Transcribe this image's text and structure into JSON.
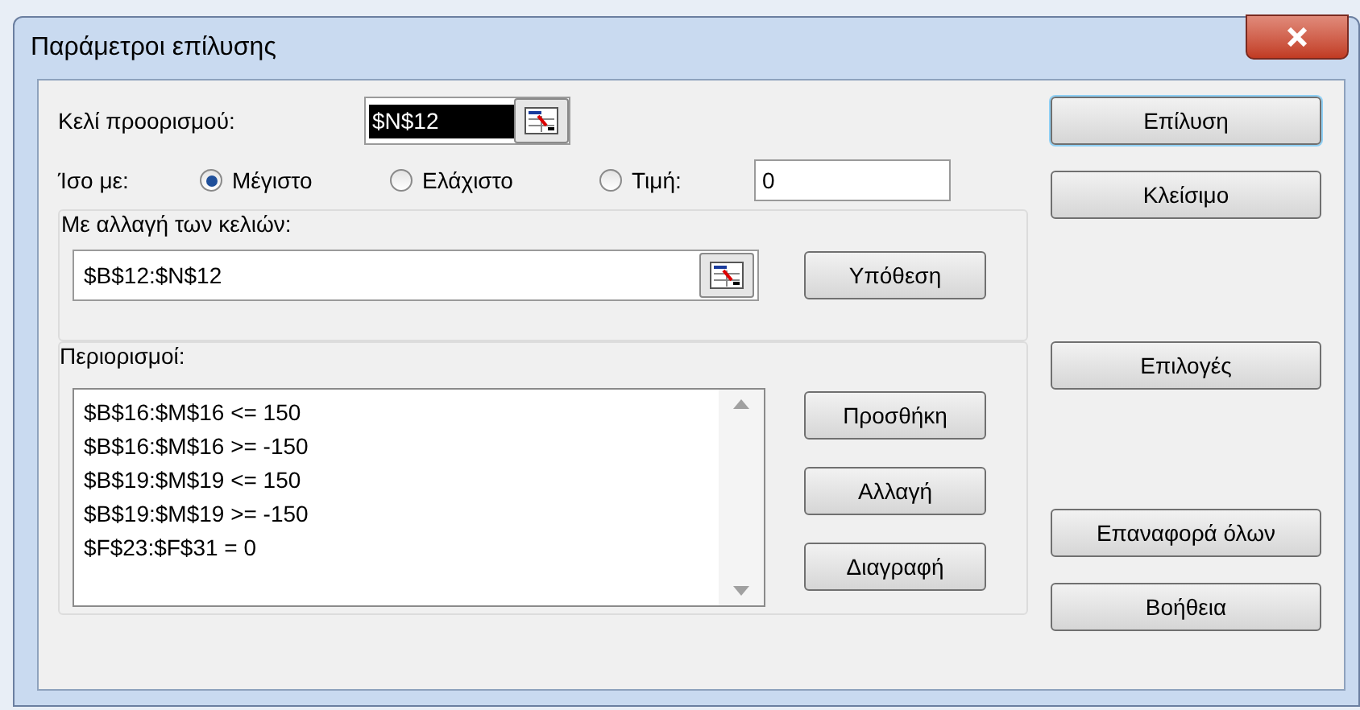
{
  "window": {
    "title": "Παράμετροι επίλυσης"
  },
  "target": {
    "label": "Κελί προορισμού:",
    "value": "$N$12",
    "selected": true
  },
  "equal_to": {
    "label": "Ίσο με:",
    "options": [
      {
        "label": "Μέγιστο",
        "selected": true
      },
      {
        "label": "Ελάχιστο",
        "selected": false
      },
      {
        "label": "Τιμή:",
        "selected": false
      }
    ],
    "value": "0"
  },
  "changing_cells": {
    "label": "Με αλλαγή των κελιών:",
    "value": "$B$12:$N$12",
    "button": "Υπόθεση"
  },
  "constraints": {
    "label": "Περιορισμοί:",
    "items": [
      "$B$16:$M$16 <= 150",
      "$B$16:$M$16 >= -150",
      "$B$19:$M$19 <= 150",
      "$B$19:$M$19 >= -150",
      "$F$23:$F$31 = 0"
    ],
    "buttons": [
      "Προσθήκη",
      "Αλλαγή",
      "Διαγραφή"
    ]
  },
  "side_buttons": [
    {
      "label": "Επίλυση",
      "default": true
    },
    {
      "label": "Κλείσιμο",
      "default": false
    },
    {
      "label": "Επιλογές",
      "default": false
    },
    {
      "label": "Επαναφορά όλων",
      "default": false
    },
    {
      "label": "Βοήθεια",
      "default": false
    }
  ]
}
